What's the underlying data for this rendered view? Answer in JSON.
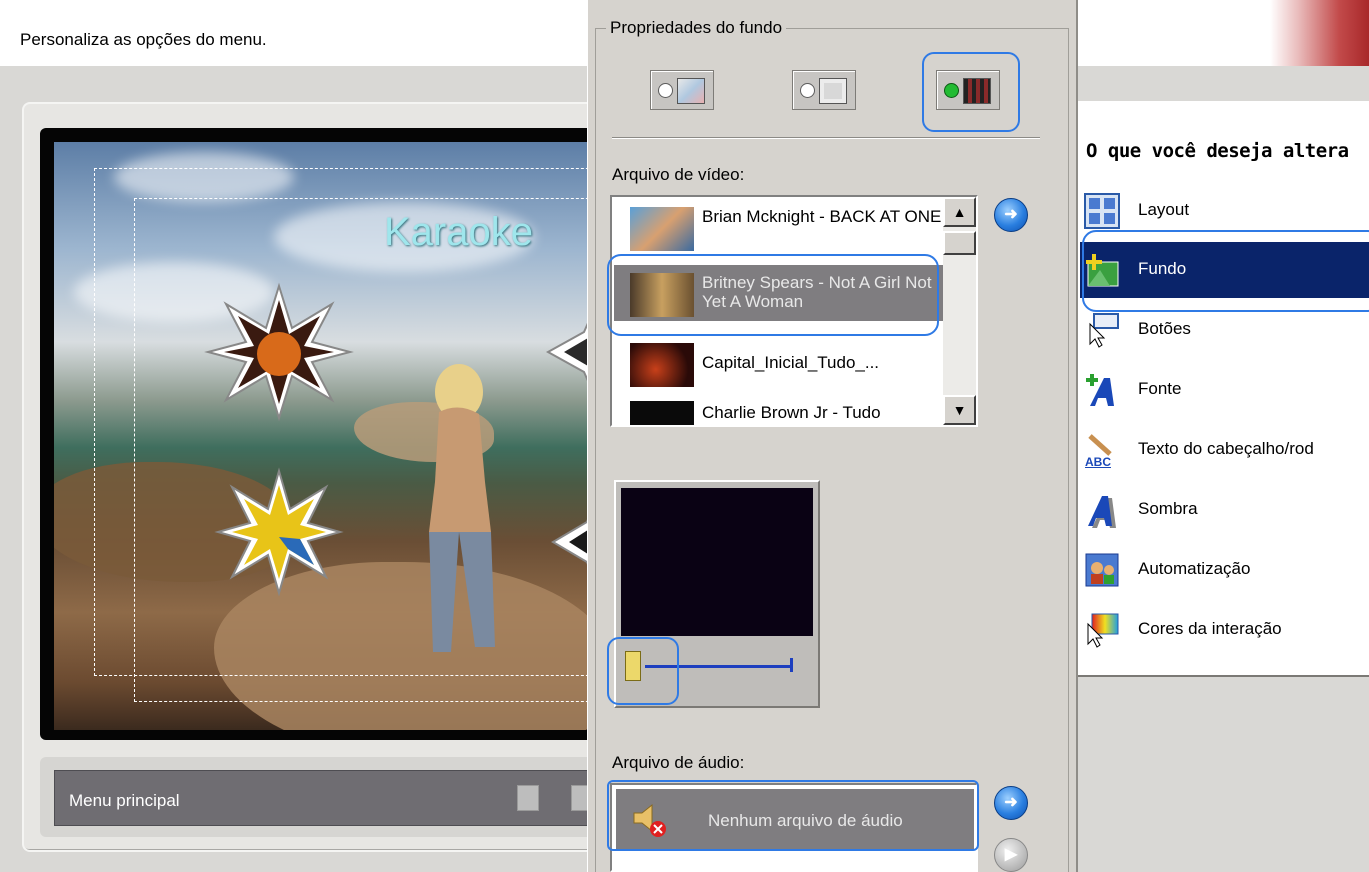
{
  "header": {
    "instruction": "Personaliza as opções do menu."
  },
  "preview": {
    "overlay_title": "Karaoke",
    "menu_label": "Menu principal"
  },
  "background_properties": {
    "group_title": "Propriedades do fundo",
    "mode_buttons": [
      "color-background",
      "image-background",
      "video-background"
    ],
    "selected_mode": "video-background",
    "video_file_label": "Arquivo de vídeo:",
    "video_files": [
      {
        "name": "Brian Mcknight - BACK AT ONE",
        "selected": false
      },
      {
        "name": "Britney Spears - Not A Girl Not Yet A Woman",
        "selected": true
      },
      {
        "name": "Capital_Inicial_Tudo_...",
        "selected": false
      },
      {
        "name": "Charlie Brown Jr - Tudo",
        "selected": false
      }
    ],
    "audio_file_label": "Arquivo de áudio:",
    "audio_files": [
      {
        "name": "Nenhum arquivo de áudio",
        "selected": true
      }
    ]
  },
  "options_panel": {
    "title": "O que você deseja altera",
    "items": [
      {
        "label": "Layout",
        "icon": "layout-icon",
        "selected": false
      },
      {
        "label": "Fundo",
        "icon": "background-icon",
        "selected": true
      },
      {
        "label": "Botões",
        "icon": "buttons-icon",
        "selected": false
      },
      {
        "label": "Fonte",
        "icon": "font-icon",
        "selected": false
      },
      {
        "label": "Texto do cabeçalho/rod",
        "icon": "header-text-icon",
        "selected": false
      },
      {
        "label": "Sombra",
        "icon": "shadow-icon",
        "selected": false
      },
      {
        "label": "Automatização",
        "icon": "automation-icon",
        "selected": false
      },
      {
        "label": "Cores da interação",
        "icon": "interaction-colors-icon",
        "selected": false
      }
    ]
  },
  "colors": {
    "selection_blue": "#0a246a",
    "highlight_ring": "#2f7ae5",
    "list_selected_gray": "#7f7d80"
  }
}
